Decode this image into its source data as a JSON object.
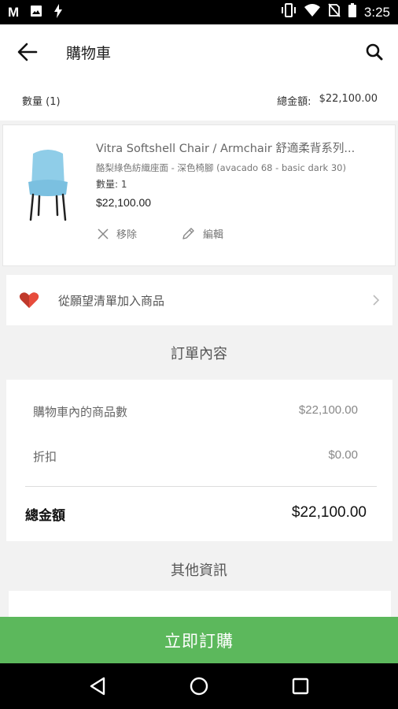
{
  "status_bar": {
    "left_icons": [
      "m-logo-icon",
      "image-icon",
      "flash-icon"
    ],
    "m_label": "M",
    "right_icons": [
      "vibrate-icon",
      "wifi-icon",
      "no-sim-icon",
      "battery-icon"
    ],
    "time": "3:25"
  },
  "toolbar": {
    "title": "購物車",
    "back_icon": "arrow-left-icon",
    "search_icon": "search-icon"
  },
  "summary": {
    "quantity_label": "數量 (1)",
    "total_label": "總金額:",
    "total_value": "$22,100.00"
  },
  "cart_item": {
    "name": "Vitra Softshell Chair / Armchair 舒適柔背系列...",
    "variant": "酪梨綠色紡織座面 - 深色椅腳 (avacado 68 - basic dark 30)",
    "quantity": "數量:  1",
    "price": "$22,100.00",
    "remove_label": "移除",
    "edit_label": "編輯"
  },
  "wishlist": {
    "label": "從願望清單加入商品",
    "icon": "heart-icon"
  },
  "order_section": {
    "title": "訂單內容",
    "rows": [
      {
        "label": "購物車內的商品數",
        "value": "$22,100.00"
      },
      {
        "label": "折扣",
        "value": "$0.00"
      }
    ],
    "total_label": "總金額",
    "total_value": "$22,100.00"
  },
  "other_section": {
    "title": "其他資訊"
  },
  "buy_button": {
    "label": "立即訂購"
  },
  "nav_bar": {
    "icons": [
      "back-triangle-icon",
      "home-circle-icon",
      "recents-square-icon"
    ]
  },
  "colors": {
    "accent_green": "#5cb85c",
    "heart_red": "#c0392b",
    "chair_blue": "#8fcde8"
  }
}
